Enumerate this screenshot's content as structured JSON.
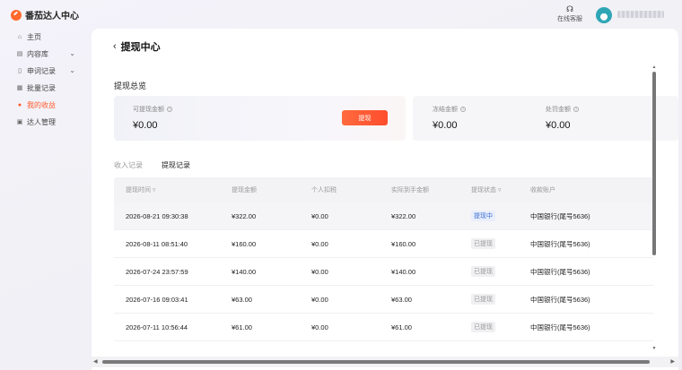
{
  "app": {
    "title": "番茄达人中心"
  },
  "header": {
    "support_label": "在线客服",
    "support_icon": "headset-icon"
  },
  "sidebar": {
    "items": [
      {
        "label": "主页",
        "icon": "home-icon",
        "active": false,
        "expandable": false
      },
      {
        "label": "内容库",
        "icon": "content-icon",
        "active": false,
        "expandable": true
      },
      {
        "label": "申词记录",
        "icon": "document-icon",
        "active": false,
        "expandable": true
      },
      {
        "label": "批量记录",
        "icon": "grid-icon",
        "active": false,
        "expandable": false
      },
      {
        "label": "我的收益",
        "icon": "coin-icon",
        "active": true,
        "expandable": false
      },
      {
        "label": "达人管理",
        "icon": "user-card-icon",
        "active": false,
        "expandable": false
      }
    ]
  },
  "page": {
    "title": "提现中心",
    "overview_title": "提现总览",
    "cards": {
      "available": {
        "label": "可提现金额",
        "value": "¥0.00",
        "button": "提现"
      },
      "frozen": {
        "label": "冻结金额",
        "value": "¥0.00"
      },
      "penalty": {
        "label": "处罚金额",
        "value": "¥0.00"
      }
    },
    "tabs": [
      {
        "label": "收入记录",
        "active": false
      },
      {
        "label": "提现记录",
        "active": true
      }
    ]
  },
  "table": {
    "headers": [
      "提现时间",
      "提现金额",
      "个人扣税",
      "实际到手金额",
      "提现状态",
      "收款账户"
    ],
    "rows": [
      {
        "time": "2026-08-21 09:30:38",
        "amount": "¥322.00",
        "tax": "¥0.00",
        "actual": "¥322.00",
        "status": "提现中",
        "account": "中国银行(尾号5636)"
      },
      {
        "time": "2026-08-11 08:51:40",
        "amount": "¥160.00",
        "tax": "¥0.00",
        "actual": "¥160.00",
        "status": "已提现",
        "account": "中国银行(尾号5636)"
      },
      {
        "time": "2026-07-24 23:57:59",
        "amount": "¥140.00",
        "tax": "¥0.00",
        "actual": "¥140.00",
        "status": "已提现",
        "account": "中国银行(尾号5636)"
      },
      {
        "time": "2026-07-16 09:03:41",
        "amount": "¥63.00",
        "tax": "¥0.00",
        "actual": "¥63.00",
        "status": "已提现",
        "account": "中国银行(尾号5636)"
      },
      {
        "time": "2026-07-11 10:56:44",
        "amount": "¥61.00",
        "tax": "¥0.00",
        "actual": "¥61.00",
        "status": "已提现",
        "account": "中国银行(尾号5636)"
      }
    ]
  },
  "colors": {
    "accent": "#ff5a2b",
    "pending_badge": "#3b6fd6"
  }
}
